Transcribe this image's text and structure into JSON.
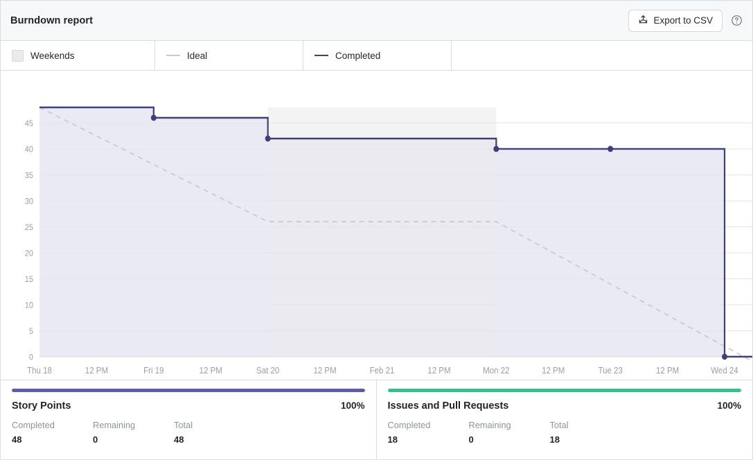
{
  "header": {
    "title": "Burndown report",
    "export_label": "Export to CSV",
    "export_icon": "upload-icon",
    "help_icon": "question-circle-icon"
  },
  "legend": {
    "items": [
      {
        "label": "Weekends",
        "marker": "box",
        "color": "#ebebeb"
      },
      {
        "label": "Ideal",
        "marker": "dashed-line",
        "color": "#c9c9cf"
      },
      {
        "label": "Completed",
        "marker": "solid-line",
        "color": "#3f3f7f"
      }
    ]
  },
  "chart_data": {
    "type": "line",
    "title": "Burndown report",
    "xlabel": "",
    "ylabel": "",
    "grid": true,
    "legend_position": "top",
    "ylim": [
      0,
      48
    ],
    "yticks": [
      0,
      5,
      10,
      15,
      20,
      25,
      30,
      35,
      40,
      45
    ],
    "xticks": [
      "Thu 18",
      "12 PM",
      "Fri 19",
      "12 PM",
      "Sat 20",
      "12 PM",
      "Feb 21",
      "12 PM",
      "Mon 22",
      "12 PM",
      "Tue 23",
      "12 PM",
      "Wed 24"
    ],
    "x": [
      "Thu 18",
      "Fri 19",
      "Sat 20",
      "Feb 21",
      "Mon 22",
      "Tue 23",
      "Wed 24"
    ],
    "series": [
      {
        "name": "Completed",
        "type": "step",
        "color": "#3f3f7f",
        "fill": "#eaeaf5",
        "points": [
          {
            "x": "Thu 18",
            "y": 48,
            "marker": false
          },
          {
            "x": "Fri 19",
            "y": 46,
            "marker": true
          },
          {
            "x": "Sat 20",
            "y": 42,
            "marker": true
          },
          {
            "x": "Mon 22",
            "y": 40,
            "marker": true
          },
          {
            "x": "Tue 23",
            "y": 40,
            "marker": true
          },
          {
            "x": "Wed 24",
            "y": 0,
            "marker": true
          }
        ]
      },
      {
        "name": "Ideal",
        "type": "dashed",
        "color": "#c9c9cf",
        "points": [
          {
            "x": "Thu 18",
            "y": 48
          },
          {
            "x": "Sat 20",
            "y": 26
          },
          {
            "x": "Mon 22",
            "y": 26
          },
          {
            "x": "Wed 24",
            "y": 2
          }
        ]
      }
    ],
    "weekend_bands": [
      {
        "from": "Sat 20",
        "to": "Mon 22",
        "color": "#ebebeb"
      }
    ]
  },
  "cards": [
    {
      "title": "Story Points",
      "percent": "100%",
      "progress": 100,
      "color": "#5b5bb5",
      "stats": [
        {
          "label": "Completed",
          "value": "48"
        },
        {
          "label": "Remaining",
          "value": "0"
        },
        {
          "label": "Total",
          "value": "48"
        }
      ]
    },
    {
      "title": "Issues and Pull Requests",
      "percent": "100%",
      "progress": 100,
      "color": "#22c98a",
      "stats": [
        {
          "label": "Completed",
          "value": "18"
        },
        {
          "label": "Remaining",
          "value": "0"
        },
        {
          "label": "Total",
          "value": "18"
        }
      ]
    }
  ]
}
